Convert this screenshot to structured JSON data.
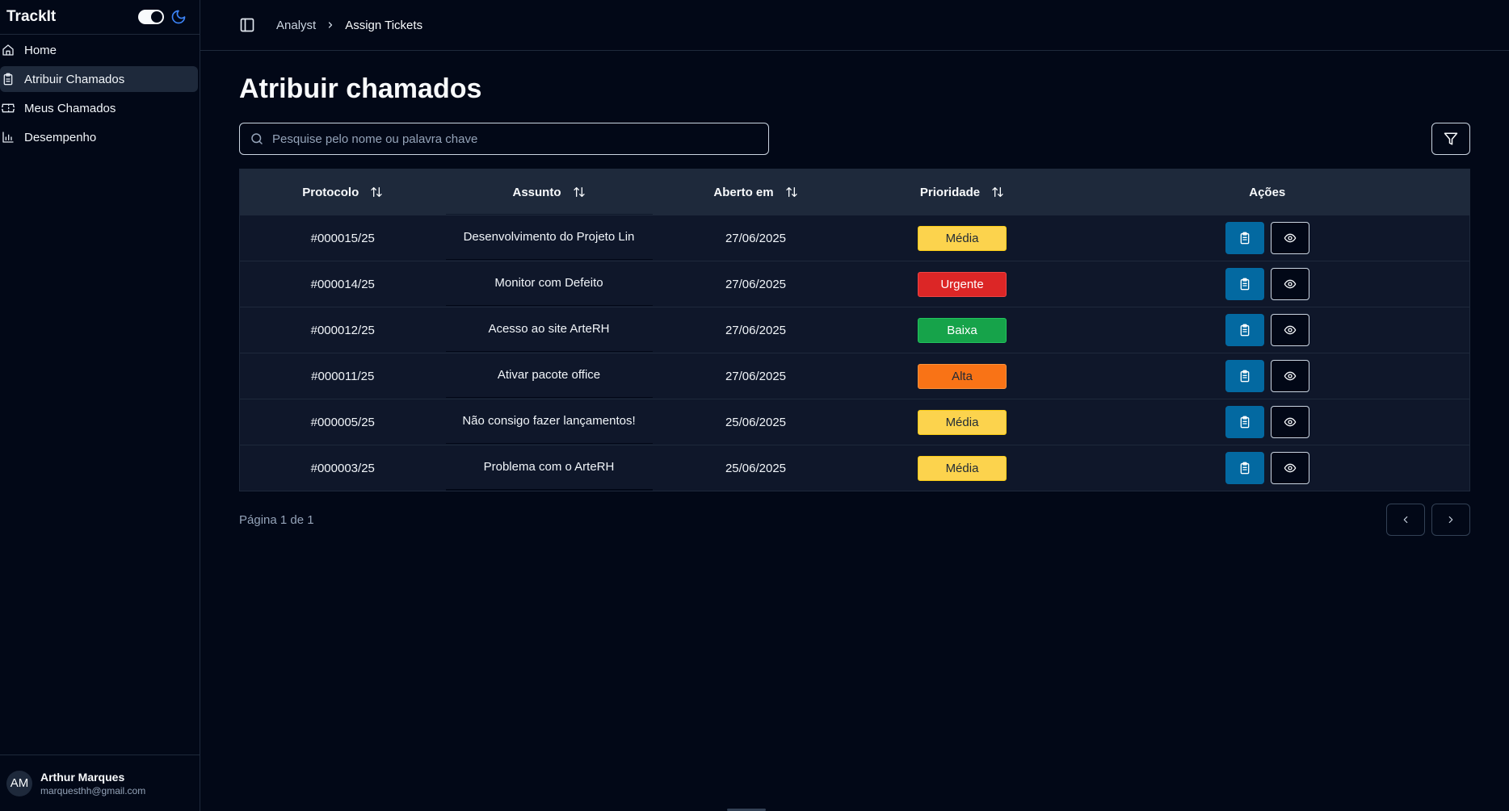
{
  "app": {
    "brand": "TrackIt"
  },
  "sidebar": {
    "items": [
      {
        "label": "Home",
        "icon": "home-icon",
        "active": false
      },
      {
        "label": "Atribuir Chamados",
        "icon": "clipboard-icon",
        "active": true
      },
      {
        "label": "Meus Chamados",
        "icon": "ticket-icon",
        "active": false
      },
      {
        "label": "Desempenho",
        "icon": "bar-chart-icon",
        "active": false
      }
    ],
    "user": {
      "initials": "AM",
      "name": "Arthur Marques",
      "email": "marquesthh@gmail.com"
    }
  },
  "breadcrumb": {
    "parent": "Analyst",
    "current": "Assign Tickets"
  },
  "page": {
    "title": "Atribuir chamados"
  },
  "search": {
    "placeholder": "Pesquise pelo nome ou palavra chave",
    "value": ""
  },
  "table": {
    "headers": {
      "protocol": "Protocolo",
      "subject": "Assunto",
      "opened": "Aberto em",
      "priority": "Prioridade",
      "actions": "Ações"
    },
    "rows": [
      {
        "protocol": "#000015/25",
        "subject": "Desenvolvimento do Projeto Lin",
        "opened": "27/06/2025",
        "priority": "Média"
      },
      {
        "protocol": "#000014/25",
        "subject": "Monitor com Defeito",
        "opened": "27/06/2025",
        "priority": "Urgente"
      },
      {
        "protocol": "#000012/25",
        "subject": "Acesso ao site ArteRH",
        "opened": "27/06/2025",
        "priority": "Baixa"
      },
      {
        "protocol": "#000011/25",
        "subject": "Ativar pacote office",
        "opened": "27/06/2025",
        "priority": "Alta"
      },
      {
        "protocol": "#000005/25",
        "subject": "Não consigo fazer lançamentos!",
        "opened": "25/06/2025",
        "priority": "Média"
      },
      {
        "protocol": "#000003/25",
        "subject": "Problema com o ArteRH",
        "opened": "25/06/2025",
        "priority": "Média"
      }
    ]
  },
  "priority_colors": {
    "Média": {
      "bg": "#fcd34d",
      "fg": "#1f2937",
      "border": "#facc15"
    },
    "Urgente": {
      "bg": "#dc2626",
      "fg": "#ffffff",
      "border": "#ef4444"
    },
    "Baixa": {
      "bg": "#16a34a",
      "fg": "#ffffff",
      "border": "#22c55e"
    },
    "Alta": {
      "bg": "#f97316",
      "fg": "#1f2937",
      "border": "#fb923c"
    }
  },
  "pagination": {
    "label": "Página 1 de 1"
  },
  "colors": {
    "background": "#020817",
    "accent": "#0369a1",
    "surface": "#1e293b"
  }
}
